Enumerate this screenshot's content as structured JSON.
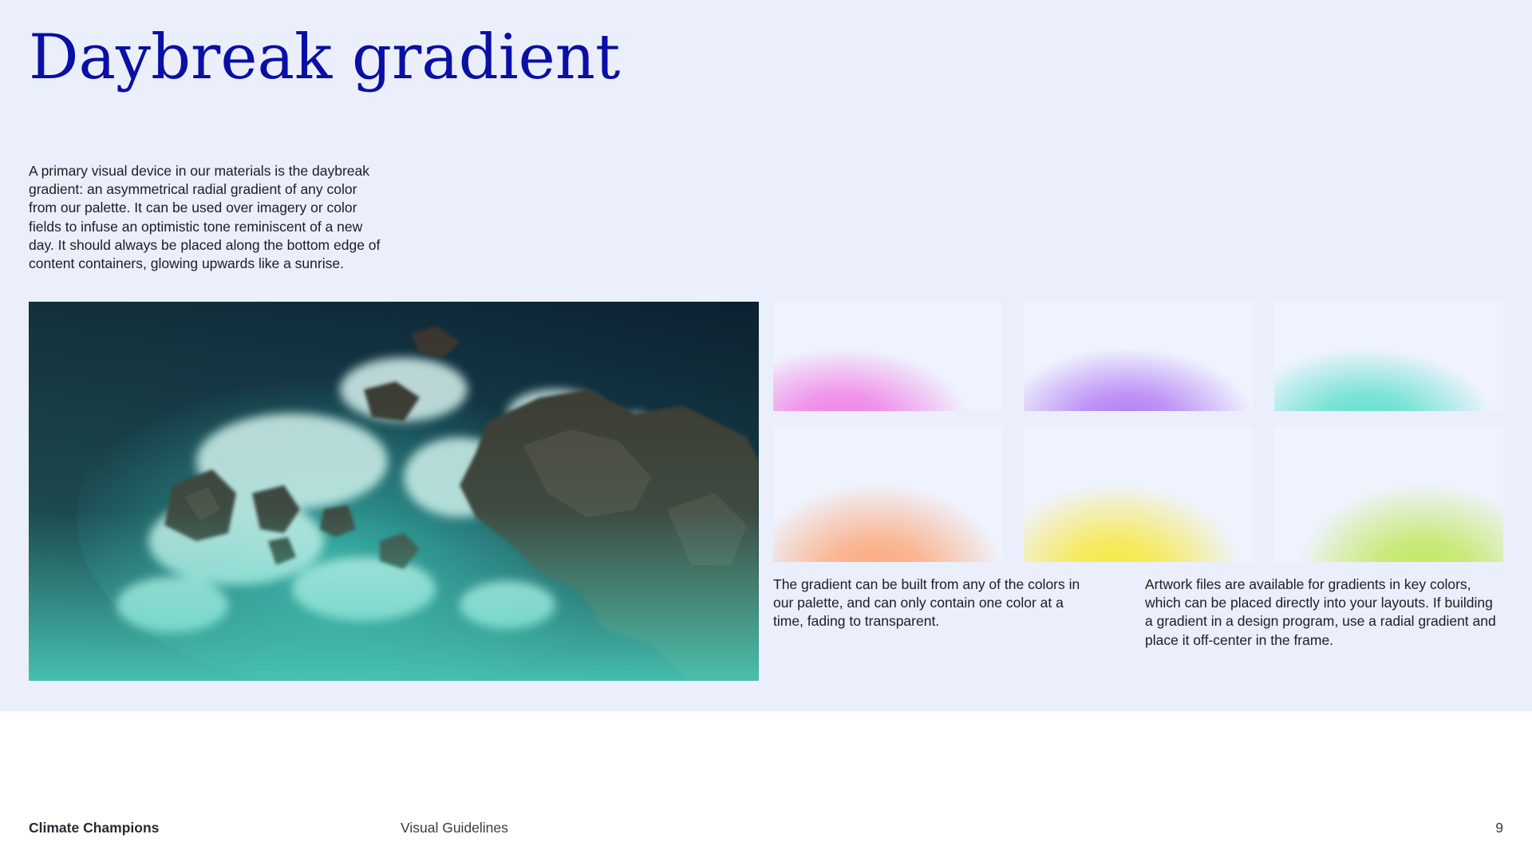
{
  "page": {
    "title": "Daybreak gradient",
    "intro": "A primary visual device in our materials is the daybreak gradient: an asymmetrical radial gradient of any color from our palette. It can be used over imagery or color fields to infuse an optimistic tone reminiscent of a new day. It should always be placed along the bottom edge of content containers, glowing upwards like a sunrise.",
    "captions": [
      "The gradient can be built from any of the colors in our palette, and can only contain one color at a time, fading to transparent.",
      "Artwork files are available for gradients in key colors, which can be placed directly into your layouts. If building a gradient in a design program, use a radial gradient and place it off-center in the frame."
    ]
  },
  "colors": {
    "background_panel": "#ebeffb",
    "title": "#0a0fa6",
    "photo_overlay": "#4fd8c2"
  },
  "swatches": [
    {
      "name": "pink",
      "color": "#f07ee6"
    },
    {
      "name": "purple",
      "color": "#b27cf4"
    },
    {
      "name": "teal",
      "color": "#5fe0cc"
    },
    {
      "name": "orange",
      "color": "#fca77a"
    },
    {
      "name": "yellow",
      "color": "#f8e83c"
    },
    {
      "name": "lime",
      "color": "#bfe85a"
    }
  ],
  "footer": {
    "brand": "Climate Champions",
    "document": "Visual Guidelines",
    "page_number": "9"
  }
}
